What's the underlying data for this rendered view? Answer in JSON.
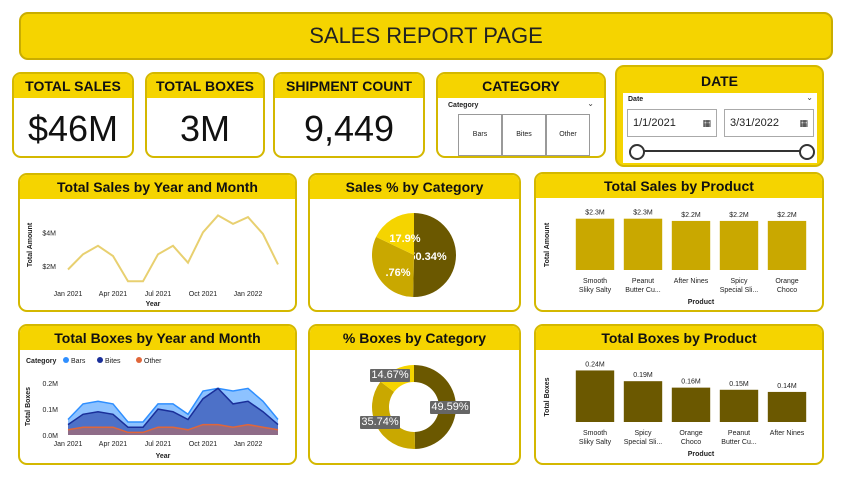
{
  "page_title": "SALES REPORT PAGE",
  "kpis": {
    "total_sales": {
      "label": "TOTAL SALES",
      "value": "$46M"
    },
    "total_boxes": {
      "label": "TOTAL BOXES",
      "value": "3M"
    },
    "shipment_count": {
      "label": "SHIPMENT COUNT",
      "value": "9,449"
    }
  },
  "category_slicer": {
    "title": "CATEGORY",
    "field_label": "Category",
    "options": [
      "Bars",
      "Bites",
      "Other"
    ]
  },
  "date_slicer": {
    "title": "DATE",
    "field_label": "Date",
    "start": "1/1/2021",
    "end": "3/31/2022"
  },
  "colors": {
    "brand_yellow": "#f5d400",
    "dark_olive": "#6b5800",
    "mustard": "#c9a800",
    "bars_blue": "#2f8fff",
    "bites_navy": "#1a2f9a",
    "other_orange": "#e0663a"
  },
  "chart_data": [
    {
      "id": "sales_line",
      "type": "line",
      "title": "Total Sales by Year and Month",
      "xlabel": "Year",
      "ylabel": "Total Amount",
      "x_ticks": [
        "Jan 2021",
        "Apr 2021",
        "Jul 2021",
        "Oct 2021",
        "Jan 2022"
      ],
      "y_ticks": [
        "$4M",
        "$2M"
      ],
      "ylim": [
        1.0,
        5.5
      ],
      "values": [
        1.8,
        2.7,
        3.2,
        2.6,
        1.1,
        1.1,
        2.7,
        3.2,
        2.2,
        4.0,
        5.0,
        4.5,
        4.9,
        3.9,
        2.1
      ],
      "color": "#e8d070"
    },
    {
      "id": "sales_pie",
      "type": "pie",
      "title": "Sales % by Category",
      "slices": [
        {
          "label": "50.34%",
          "value": 50.34,
          "color": "#6b5800"
        },
        {
          "label": ".76%",
          "value": 31.76,
          "color": "#c9a800"
        },
        {
          "label": "17.9%",
          "value": 17.9,
          "color": "#f5d400"
        }
      ]
    },
    {
      "id": "sales_by_product",
      "type": "bar",
      "title": "Total Sales by Product",
      "xlabel": "Product",
      "ylabel": "Total Amount",
      "categories": [
        [
          "Smooth",
          "Sliky Salty"
        ],
        [
          "Peanut",
          "Butter Cu..."
        ],
        [
          "After Nines"
        ],
        [
          "Spicy",
          "Special Sli..."
        ],
        [
          "Orange",
          "Choco"
        ]
      ],
      "values": [
        2.3,
        2.3,
        2.2,
        2.2,
        2.2
      ],
      "value_labels": [
        "$2.3M",
        "$2.3M",
        "$2.2M",
        "$2.2M",
        "$2.2M"
      ],
      "ylim": [
        0,
        2.6
      ],
      "color": "#c9a800"
    },
    {
      "id": "boxes_area",
      "type": "area",
      "title": "Total Boxes by Year and Month",
      "legend_title": "Category",
      "xlabel": "Year",
      "ylabel": "Total Boxes",
      "x_ticks": [
        "Jan 2021",
        "Apr 2021",
        "Jul 2021",
        "Oct 2021",
        "Jan 2022"
      ],
      "y_ticks": [
        "0.2M",
        "0.1M",
        "0.0M"
      ],
      "ylim": [
        0,
        0.22
      ],
      "series": [
        {
          "name": "Bars",
          "color": "#2f8fff",
          "values": [
            0.06,
            0.12,
            0.13,
            0.12,
            0.05,
            0.05,
            0.12,
            0.12,
            0.08,
            0.17,
            0.18,
            0.17,
            0.18,
            0.13,
            0.06
          ]
        },
        {
          "name": "Bites",
          "color": "#1a2f9a",
          "values": [
            0.04,
            0.08,
            0.09,
            0.08,
            0.03,
            0.03,
            0.1,
            0.09,
            0.06,
            0.14,
            0.18,
            0.12,
            0.13,
            0.09,
            0.04
          ]
        },
        {
          "name": "Other",
          "color": "#e0663a",
          "values": [
            0.02,
            0.03,
            0.03,
            0.03,
            0.01,
            0.01,
            0.03,
            0.03,
            0.02,
            0.04,
            0.04,
            0.03,
            0.04,
            0.03,
            0.02
          ]
        }
      ]
    },
    {
      "id": "boxes_donut",
      "type": "pie",
      "title": "% Boxes by Category",
      "slices": [
        {
          "label": "49.59%",
          "value": 49.59,
          "color": "#6b5800"
        },
        {
          "label": "35.74%",
          "value": 35.74,
          "color": "#c9a800"
        },
        {
          "label": "14.67%",
          "value": 14.67,
          "color": "#f5d400"
        }
      ]
    },
    {
      "id": "boxes_by_product",
      "type": "bar",
      "title": "Total Boxes by Product",
      "xlabel": "Product",
      "ylabel": "Total Boxes",
      "categories": [
        [
          "Smooth",
          "Sliky Salty"
        ],
        [
          "Spicy",
          "Special Sli..."
        ],
        [
          "Orange",
          "Choco"
        ],
        [
          "Peanut",
          "Butter Cu..."
        ],
        [
          "After Nines"
        ]
      ],
      "values": [
        0.24,
        0.19,
        0.16,
        0.15,
        0.14
      ],
      "value_labels": [
        "0.24M",
        "0.19M",
        "0.16M",
        "0.15M",
        "0.14M"
      ],
      "ylim": [
        0,
        0.27
      ],
      "color": "#6b5800"
    }
  ]
}
